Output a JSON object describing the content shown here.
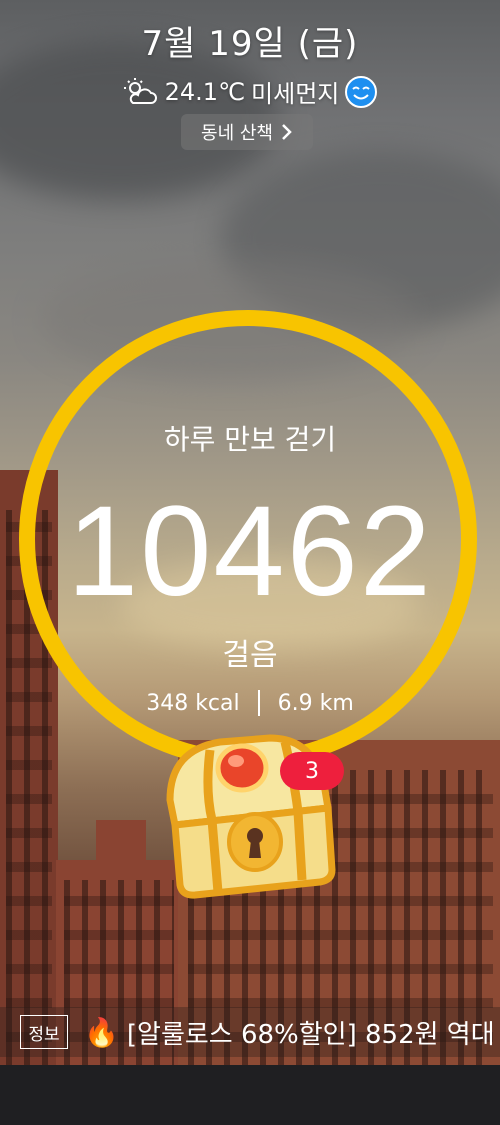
{
  "header": {
    "date": "7월 19일 (금)",
    "temperature": "24.1℃",
    "dust_label": "미세먼지",
    "walk_button": "동네 산책"
  },
  "pedometer": {
    "title": "하루 만보 걷기",
    "steps": "10462",
    "unit": "걸음",
    "calories": "348 kcal",
    "distance": "6.9 km",
    "ring_color": "#f8c400"
  },
  "reward": {
    "badge_count": "3"
  },
  "ticker": {
    "tag": "정보",
    "text": "[알룰로스 68%할인] 852원 역대"
  },
  "icons": [
    "weather-partly-cloudy-icon",
    "smile-face-icon",
    "chevron-right-icon",
    "treasure-chest-icon",
    "fire-icon"
  ]
}
